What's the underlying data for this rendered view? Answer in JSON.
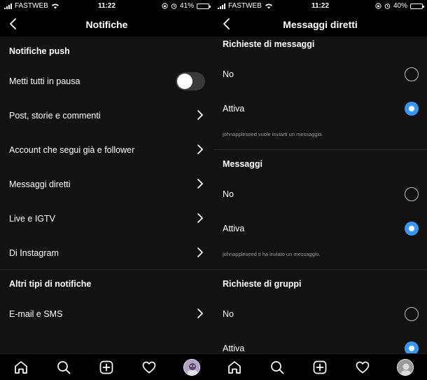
{
  "status_left": {
    "carrier": "FASTWEB",
    "time": "11:22",
    "battery": "41%",
    "battery_level": 0.41
  },
  "status_right": {
    "carrier": "FASTWEB",
    "time": "11:22",
    "battery": "40%",
    "battery_level": 0.4
  },
  "left": {
    "title": "Notifiche",
    "sections": [
      {
        "title": "Notifiche push"
      },
      {
        "title": "Altri tipi di notifiche"
      }
    ],
    "pause_label": "Metti tutti in pausa",
    "pause_on": false,
    "items": [
      "Post, storie e commenti",
      "Account che segui già e follower",
      "Messaggi diretti",
      "Live e IGTV",
      "Di Instagram"
    ],
    "other_items": [
      "E-mail e SMS"
    ]
  },
  "right": {
    "title": "Messaggi diretti",
    "groups": [
      {
        "title": "Richieste di messaggi",
        "options": [
          "No",
          "Attiva"
        ],
        "selected": 1,
        "note": "johnappleseed vuole inviarti un messaggio."
      },
      {
        "title": "Messaggi",
        "options": [
          "No",
          "Attiva"
        ],
        "selected": 1,
        "note": "johnappleseed ti ha inviato un messaggio."
      },
      {
        "title": "Richieste di gruppi",
        "options": [
          "No",
          "Attiva"
        ],
        "selected": 1
      }
    ]
  },
  "tabbar": {
    "icons": [
      "home-icon",
      "search-icon",
      "new-post-icon",
      "activity-heart-icon",
      "profile-avatar"
    ]
  },
  "colors": {
    "accent": "#3897f0",
    "background": "#121212",
    "battery": "#f4c430"
  }
}
